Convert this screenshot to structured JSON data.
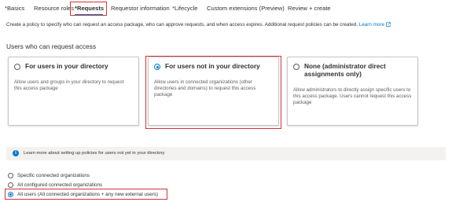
{
  "tabs": [
    {
      "label": "*Basics"
    },
    {
      "label": "Resource roles"
    },
    {
      "label": "*Requests"
    },
    {
      "label": "Requestor information"
    },
    {
      "label": "*Lifecycle"
    },
    {
      "label": "Custom extensions (Preview)"
    },
    {
      "label": "Review + create"
    }
  ],
  "description": {
    "text": "Create a policy to specify who can request an access package, who can approve requests, and when access expires. Additional request policies can be created.",
    "link": "Learn more",
    "link_icon": "external-link-icon"
  },
  "section_title": "Users who can request access",
  "cards": [
    {
      "title": "For users in your directory",
      "desc": "Allow users and groups in your directory to request this access package",
      "selected": false
    },
    {
      "title": "For users not in your directory",
      "desc": "Allow users in connected organizations (other directories and domains) to request this access package",
      "selected": true
    },
    {
      "title": "None (administrator direct assignments only)",
      "desc": "Allow administrators to directly assign specific users to this access package. Users cannot request this access package",
      "selected": false
    }
  ],
  "info": {
    "icon": "info-icon",
    "text": "Learn more about setting up policies for users not yet in your directory"
  },
  "options": [
    {
      "label": "Specific connected organizations",
      "selected": false
    },
    {
      "label": "All configured connected organizations",
      "selected": false
    },
    {
      "label": "All users (All connected organizations + any new external users)",
      "selected": true
    }
  ],
  "colors": {
    "accent": "#0078d4",
    "highlight": "#d13438"
  }
}
